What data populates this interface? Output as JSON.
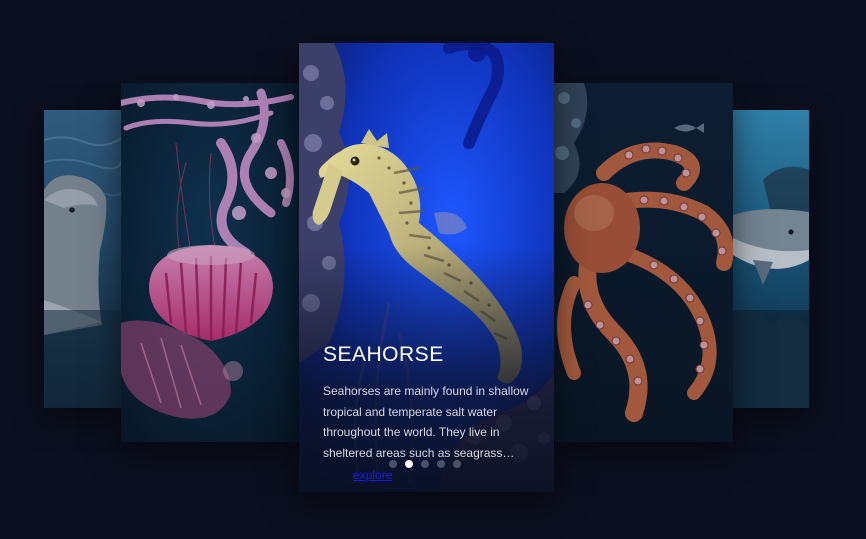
{
  "slides": [
    {
      "name": "Dolphin",
      "art": "dolphin-photo"
    },
    {
      "name": "Jellyfish",
      "art": "jellyfish-photo"
    },
    {
      "name": "Seahorse",
      "art": "seahorse-photo"
    },
    {
      "name": "Octopus",
      "art": "octopus-photo"
    },
    {
      "name": "Shark",
      "art": "shark-photo"
    }
  ],
  "active_card": {
    "title": "SEAHORSE",
    "description": "Seahorses are mainly found in shallow tropical and temperate salt water throughout the world. They live in sheltered areas such as seagrass…",
    "link_label": "explore"
  },
  "pagination": {
    "count": 5,
    "active_index": 1
  },
  "colors": {
    "background": "#0c0f1f",
    "ocean_blue": "#1a4fd6",
    "jelly_pink": "#e05aa0",
    "octopus_orange": "#c0603c",
    "link": "#1a1adf",
    "dot_active": "#ffffff"
  }
}
